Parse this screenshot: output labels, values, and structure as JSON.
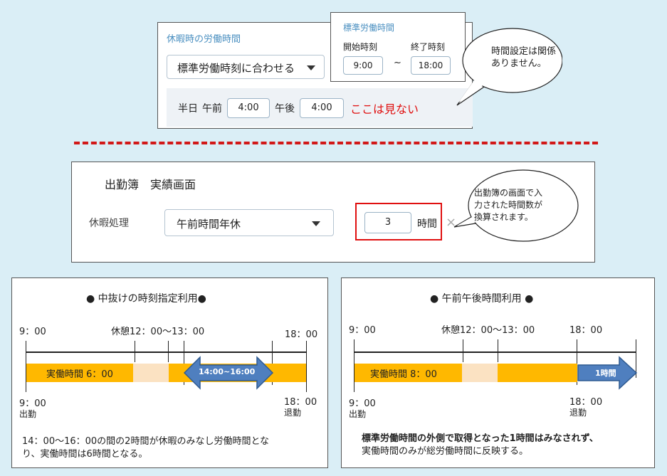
{
  "top_panel": {
    "title": "休暇時の労働時間",
    "select_value": "標準労働時刻に合わせる",
    "half_day_label": "半日",
    "am_label": "午前",
    "am_value": "4:00",
    "pm_label": "午後",
    "pm_value": "4:00",
    "ignore_note": "ここは見ない"
  },
  "std_popup": {
    "title": "標準労働時間",
    "start_label": "開始時刻",
    "end_label": "終了時刻",
    "start_value": "9:00",
    "tilde": "~",
    "end_value": "18:00"
  },
  "bubble1": {
    "line1": "時間設定は関係",
    "line2": "ありません。"
  },
  "attendance": {
    "title": "出勤簿　実績画面",
    "leave_label": "休暇処理",
    "select_value": "午前時間年休",
    "hours_value": "3",
    "hours_unit": "時間",
    "close_glyph": "×"
  },
  "bubble2": {
    "line1": "出勤簿の画面で入",
    "line2": "力された時間数が",
    "line3": "換算されます。"
  },
  "left_panel": {
    "title": "● 中抜けの時刻指定利用●",
    "t_start": "9：00",
    "t_break": "休憩12：00～13：00",
    "t_end": "18：00",
    "bar_label": "実働時間 6：00",
    "arrow_label": "14:00~16:00",
    "b_start": "9：00",
    "b_start_sub": "出勤",
    "b_end": "18：00",
    "b_end_sub": "退勤",
    "note_line1": "14：00～16：00の間の2時間が休暇のみなし労働時間とな",
    "note_line2": "り、実働時間は6時間となる。"
  },
  "right_panel": {
    "title": "● 午前午後時間利用 ●",
    "t_start": "9：00",
    "t_break": "休憩12：00～13：00",
    "t_end": "18：00",
    "bar_label": "実働時間 8：00",
    "arrow_label": "1時間",
    "b_start": "9：00",
    "b_start_sub": "出勤",
    "b_end": "18：00",
    "b_end_sub": "退勤",
    "note_line1": "標準労働時間の外側で取得となった1時間はみなされず、",
    "note_line2": "実働時間のみが総労働時間に反映する。"
  },
  "colors": {
    "accent_red": "#e01010",
    "bar_orange": "#ffb800",
    "arrow_blue": "#4f7fbf"
  }
}
